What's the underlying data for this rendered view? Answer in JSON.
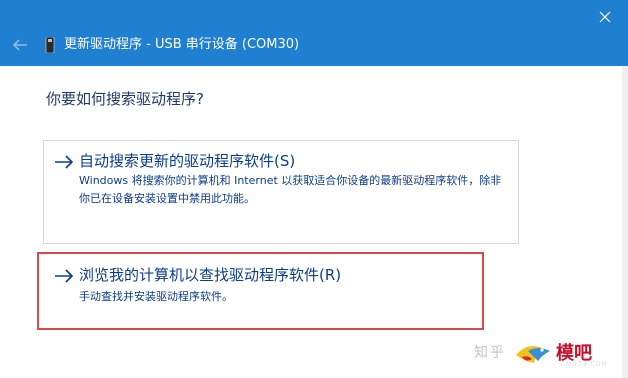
{
  "window": {
    "title": "更新驱动程序 - USB 串行设备 (COM30)"
  },
  "page": {
    "question": "你要如何搜索驱动程序?"
  },
  "options": [
    {
      "title": "自动搜索更新的驱动程序软件(S)",
      "description": "Windows 将搜索你的计算机和 Internet 以获取适合你设备的最新驱动程序软件，除非你已在设备安装设置中禁用此功能。"
    },
    {
      "title": "浏览我的计算机以查找驱动程序软件(R)",
      "description": "手动查找并安装驱动程序软件。"
    }
  ],
  "watermark": {
    "left_text": "知乎",
    "brand": "模吧",
    "url": "MOZ8.COM"
  },
  "colors": {
    "titlebar": "#1f7fd0",
    "link_text": "#0b3d8c",
    "heading_text": "#1f3a67",
    "highlight_border": "#d84a4a"
  },
  "icons": {
    "close": "close-icon",
    "back": "back-arrow-icon",
    "device": "usb-device-icon",
    "option_arrow": "right-arrow-icon"
  }
}
